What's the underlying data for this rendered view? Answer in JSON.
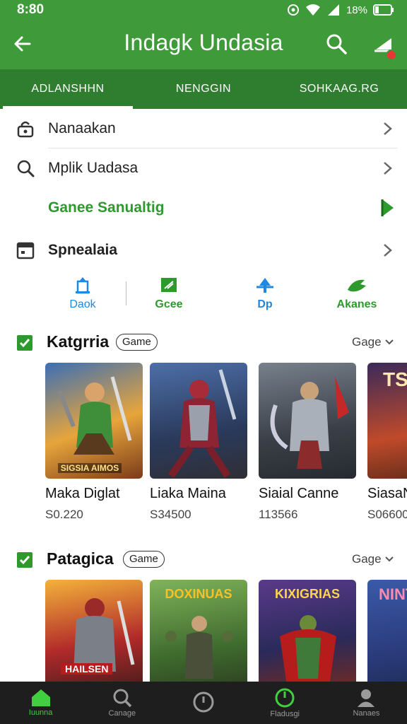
{
  "status": {
    "time": "8:80",
    "battery": "18%"
  },
  "appbar": {
    "title": "Indagk Undasia"
  },
  "tabs": [
    {
      "label": "ADLANSHHN",
      "active": true
    },
    {
      "label": "NENGGIN",
      "active": false
    },
    {
      "label": "SOHKAAG.RG",
      "active": false
    }
  ],
  "menu": {
    "item1": "Nanaakan",
    "item2": "Mplik Uadasa",
    "item3": "Ganee Sanualtig",
    "item4": "Spnealaia"
  },
  "quick": [
    {
      "label": "Daok",
      "color": "#1e88e5",
      "icon": "building-icon"
    },
    {
      "label": "Gcee",
      "color": "#2e9a2e",
      "icon": "tag-icon"
    },
    {
      "label": "Dp",
      "color": "#1e88e5",
      "icon": "plane-icon"
    },
    {
      "label": "Akanes",
      "color": "#2e9a2e",
      "icon": "bird-icon"
    }
  ],
  "section1": {
    "title": "Katgrria",
    "pill": "Game",
    "sort": "Gage",
    "cards": [
      {
        "name": "Maka Diglat",
        "price": "S0.220",
        "art_text": "SIGSIA AIMOS"
      },
      {
        "name": "Liaka Maina",
        "price": "S34500",
        "art_text": ""
      },
      {
        "name": "Siaial Canne",
        "price": "113566",
        "art_text": ""
      },
      {
        "name": "SiasaN",
        "price": "S06600",
        "art_text": "TS"
      }
    ]
  },
  "section2": {
    "title": "Patagica",
    "pill": "Game",
    "sort": "Gage",
    "cards": [
      {
        "art_text": "HAILSEN"
      },
      {
        "art_text": "DOXINUAS"
      },
      {
        "art_text": "KIXIGRIAS"
      },
      {
        "art_text": "NINTE"
      }
    ]
  },
  "bottomnav": [
    {
      "label": "Iuunna",
      "icon": "home-icon",
      "active": true
    },
    {
      "label": "Canage",
      "icon": "search-icon",
      "active": false
    },
    {
      "label": "",
      "icon": "clock-icon",
      "active": false
    },
    {
      "label": "Fladusgi",
      "icon": "power-icon",
      "active": false
    },
    {
      "label": "Nanaes",
      "icon": "person-icon",
      "active": false
    }
  ],
  "colors": {
    "brand": "#3f9a3a",
    "tab_bar": "#2f7d2e",
    "accent_green": "#2e9a2e",
    "accent_blue": "#1e88e5"
  }
}
